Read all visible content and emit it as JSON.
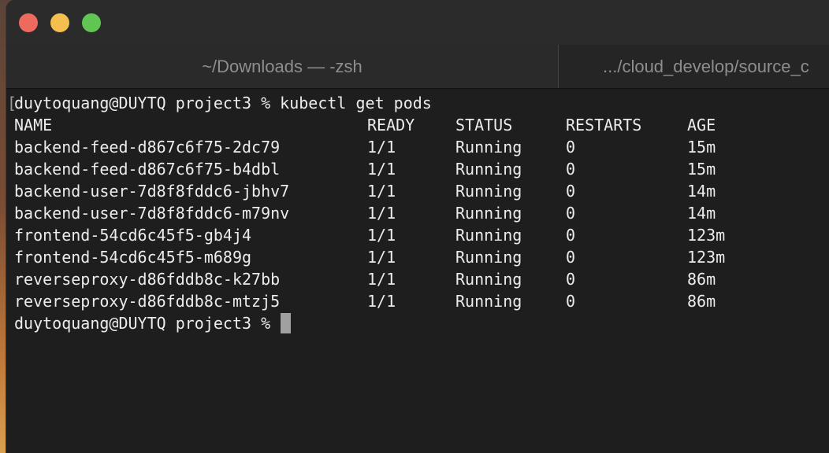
{
  "window": {
    "tabs": [
      {
        "label": "~/Downloads — -zsh"
      },
      {
        "label": ".../cloud_develop/source_c"
      }
    ]
  },
  "terminal": {
    "prompt": "duytoquang@DUYTQ project3 % ",
    "command": "kubectl get pods",
    "headers": {
      "name": "NAME",
      "ready": "READY",
      "status": "STATUS",
      "restarts": "RESTARTS",
      "age": "AGE"
    },
    "rows": [
      {
        "name": "backend-feed-d867c6f75-2dc79",
        "ready": "1/1",
        "status": "Running",
        "restarts": "0",
        "age": "15m"
      },
      {
        "name": "backend-feed-d867c6f75-b4dbl",
        "ready": "1/1",
        "status": "Running",
        "restarts": "0",
        "age": "15m"
      },
      {
        "name": "backend-user-7d8f8fddc6-jbhv7",
        "ready": "1/1",
        "status": "Running",
        "restarts": "0",
        "age": "14m"
      },
      {
        "name": "backend-user-7d8f8fddc6-m79nv",
        "ready": "1/1",
        "status": "Running",
        "restarts": "0",
        "age": "14m"
      },
      {
        "name": "frontend-54cd6c45f5-gb4j4",
        "ready": "1/1",
        "status": "Running",
        "restarts": "0",
        "age": "123m"
      },
      {
        "name": "frontend-54cd6c45f5-m689g",
        "ready": "1/1",
        "status": "Running",
        "restarts": "0",
        "age": "123m"
      },
      {
        "name": "reverseproxy-d86fddb8c-k27bb",
        "ready": "1/1",
        "status": "Running",
        "restarts": "0",
        "age": "86m"
      },
      {
        "name": "reverseproxy-d86fddb8c-mtzj5",
        "ready": "1/1",
        "status": "Running",
        "restarts": "0",
        "age": "86m"
      }
    ],
    "final_prompt": "duytoquang@DUYTQ project3 % "
  }
}
